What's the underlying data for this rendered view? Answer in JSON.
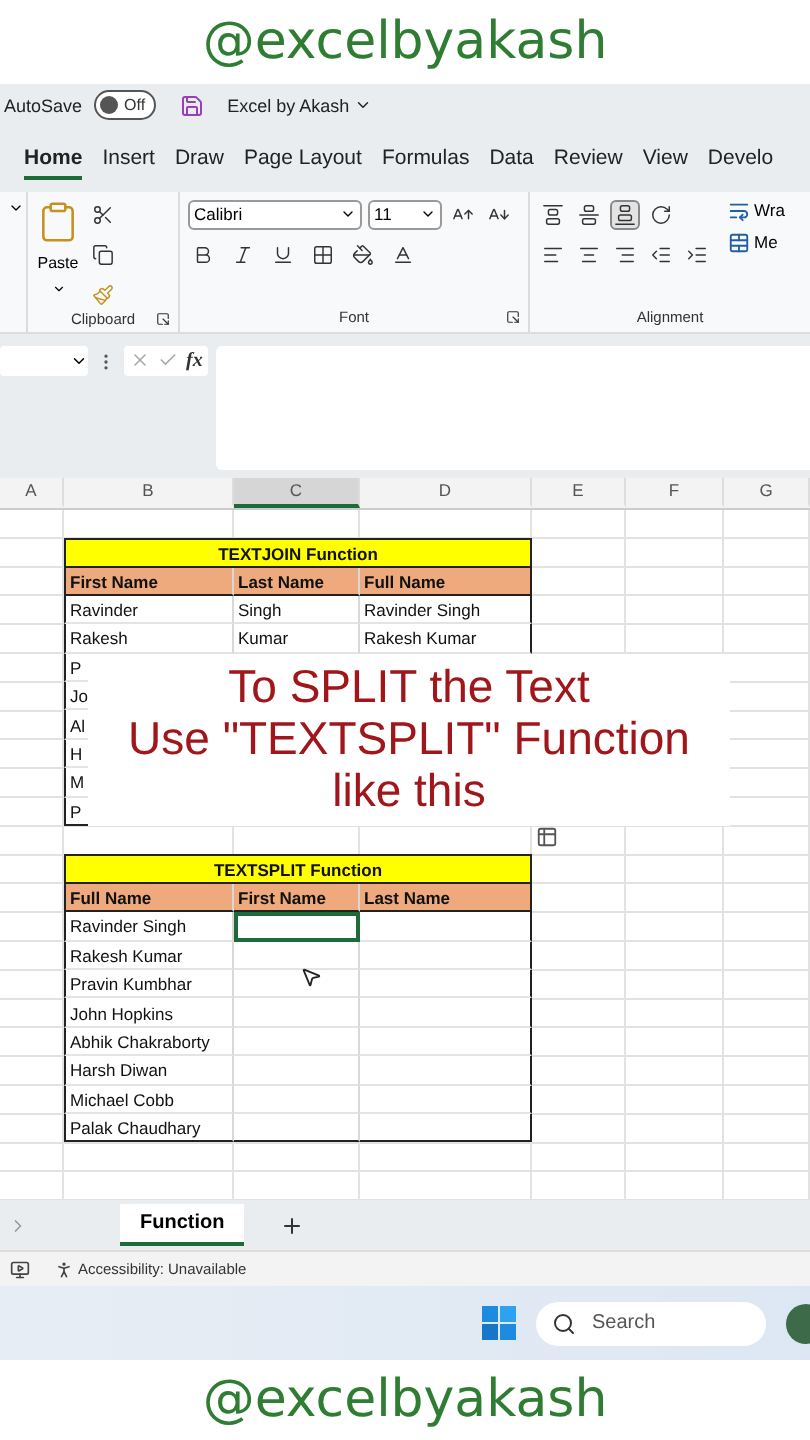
{
  "caption_top": "@excelbyakash",
  "title_bar": {
    "autosave_label": "AutoSave",
    "autosave_on": false,
    "autosave_state": "Off",
    "file_name": "Excel by Akash"
  },
  "ribbon": {
    "tabs": [
      {
        "label": "Home",
        "selected": true
      },
      {
        "label": "Insert",
        "selected": false
      },
      {
        "label": "Draw",
        "selected": false
      },
      {
        "label": "Page Layout",
        "selected": false
      },
      {
        "label": "Formulas",
        "selected": false
      },
      {
        "label": "Data",
        "selected": false
      },
      {
        "label": "Review",
        "selected": false
      },
      {
        "label": "View",
        "selected": false
      },
      {
        "label": "Develo",
        "selected": false
      }
    ],
    "paste_label": "Paste",
    "font_name": "Calibri",
    "font_size": "11",
    "wrap_label": "Wra",
    "merge_label": "Me",
    "groups": [
      "Clipboard",
      "Font",
      "Alignment"
    ]
  },
  "formula_bar": {
    "function_label": "fx"
  },
  "column_headers": [
    {
      "label": "A",
      "selected": false
    },
    {
      "label": "B",
      "selected": false
    },
    {
      "label": "C",
      "selected": true
    },
    {
      "label": "D",
      "selected": false
    },
    {
      "label": "E",
      "selected": false
    },
    {
      "label": "F",
      "selected": false
    },
    {
      "label": "G",
      "selected": false
    }
  ],
  "tables": [
    {
      "title": "TEXTJOIN Function",
      "columns": [
        "First Name",
        "Last Name",
        "Full Name"
      ],
      "rows": [
        {
          "cells": [
            {
              "text": "Ravinder",
              "selected": false
            },
            {
              "text": "Singh",
              "selected": false
            },
            {
              "text": "Ravinder Singh",
              "selected": false
            }
          ]
        },
        {
          "cells": [
            {
              "text": "Rakesh",
              "selected": false
            },
            {
              "text": "Kumar",
              "selected": false
            },
            {
              "text": "Rakesh Kumar",
              "selected": false
            }
          ]
        },
        {
          "cells": [
            {
              "text": "P",
              "selected": false
            }
          ]
        },
        {
          "cells": [
            {
              "text": "Jo",
              "selected": false
            }
          ]
        },
        {
          "cells": [
            {
              "text": "Al",
              "selected": false
            }
          ]
        },
        {
          "cells": [
            {
              "text": "H",
              "selected": false
            }
          ]
        },
        {
          "cells": [
            {
              "text": "M",
              "selected": false
            }
          ]
        },
        {
          "cells": [
            {
              "text": "P",
              "selected": false
            }
          ]
        }
      ]
    },
    {
      "title": "TEXTSPLIT Function",
      "columns": [
        "Full Name",
        "First Name",
        "Last Name"
      ],
      "rows": [
        {
          "cells": [
            {
              "text": "Ravinder Singh",
              "selected": false
            },
            {
              "selected": true
            },
            {
              "selected": false
            }
          ]
        },
        {
          "cells": [
            {
              "text": "Rakesh Kumar",
              "selected": false
            },
            {
              "selected": false
            },
            {
              "selected": false
            }
          ]
        },
        {
          "cells": [
            {
              "text": "Pravin Kumbhar",
              "selected": false
            },
            {
              "selected": false
            },
            {
              "selected": false
            }
          ]
        },
        {
          "cells": [
            {
              "text": "John Hopkins",
              "selected": false
            },
            {
              "selected": false
            },
            {
              "selected": false
            }
          ]
        },
        {
          "cells": [
            {
              "text": "Abhik Chakraborty",
              "selected": false
            },
            {
              "selected": false
            },
            {
              "selected": false
            }
          ]
        },
        {
          "cells": [
            {
              "text": "Harsh Diwan",
              "selected": false
            },
            {
              "selected": false
            },
            {
              "selected": false
            }
          ]
        },
        {
          "cells": [
            {
              "text": "Michael Cobb",
              "selected": false
            },
            {
              "selected": false
            },
            {
              "selected": false
            }
          ]
        },
        {
          "cells": [
            {
              "text": "Palak Chaudhary",
              "selected": false
            },
            {
              "selected": false
            },
            {
              "selected": false
            }
          ]
        }
      ]
    }
  ],
  "overlay_lines": [
    "To SPLIT the Text",
    "Use \"TEXTSPLIT\" Function",
    "like this"
  ],
  "sheet_tabs": [
    {
      "label": "Function",
      "selected": true
    }
  ],
  "status_bar": {
    "accessibility": "Accessibility: Unavailable"
  },
  "taskbar": {
    "search_placeholder": "Search"
  },
  "caption_bottom": "@excelbyakash"
}
